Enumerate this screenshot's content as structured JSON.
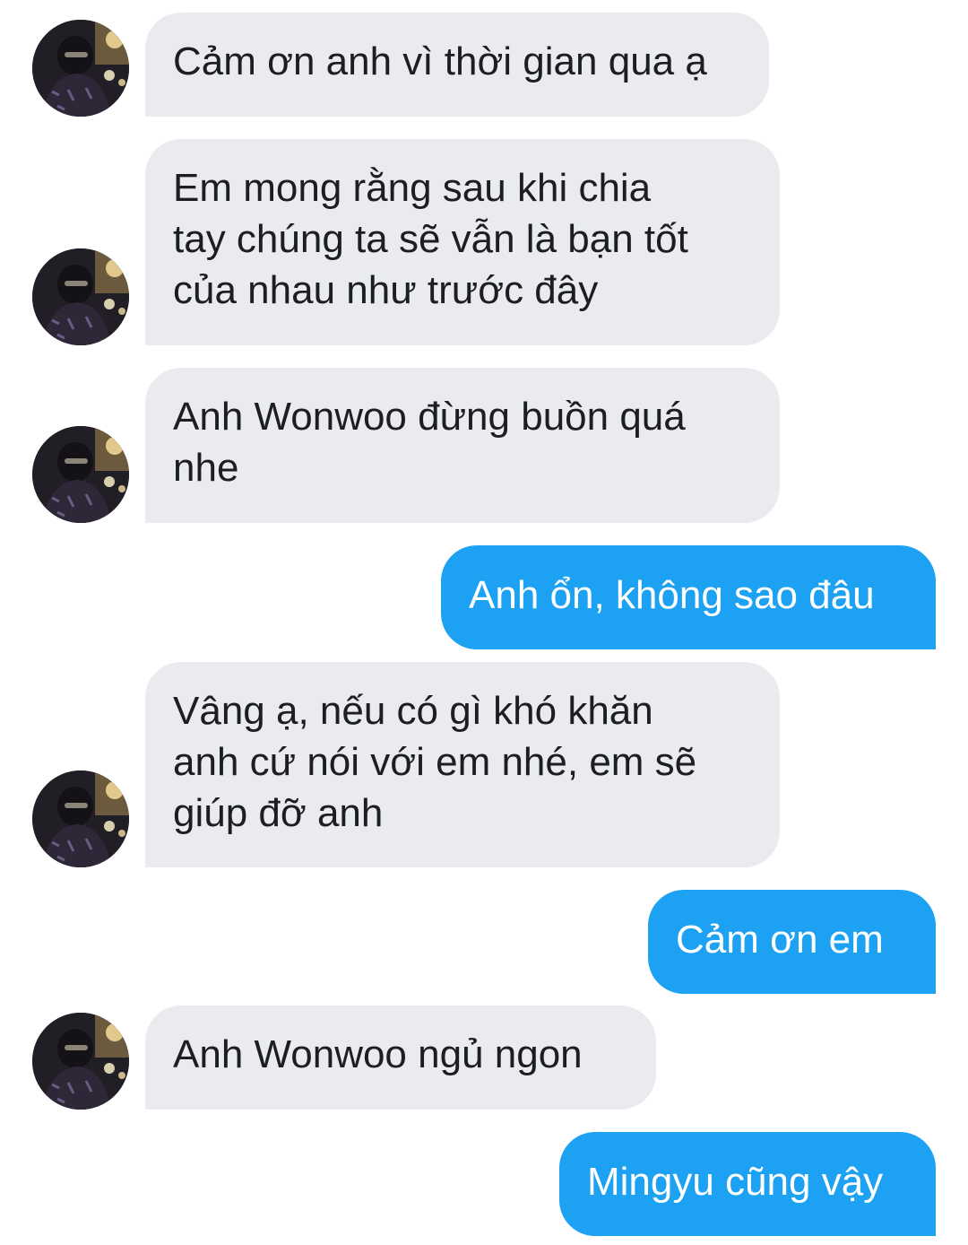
{
  "conversation": {
    "messages": [
      {
        "sender": "other",
        "text": "Cảm ơn anh vì thời gian qua ạ"
      },
      {
        "sender": "other",
        "text": "Em mong rằng sau khi chia\ntay chúng ta sẽ vẫn là bạn tốt\ncủa nhau như trước đây"
      },
      {
        "sender": "other",
        "text": "Anh Wonwoo đừng buồn quá\nnhe"
      },
      {
        "sender": "self",
        "text": "Anh ổn, không sao đâu"
      },
      {
        "sender": "other",
        "text": "Vâng ạ, nếu có gì khó khăn\nanh cứ nói với em nhé, em sẽ\ngiúp đỡ anh"
      },
      {
        "sender": "self",
        "text": "Cảm ơn em"
      },
      {
        "sender": "other",
        "text": "Anh Wonwoo ngủ ngon"
      },
      {
        "sender": "self",
        "text": "Mingyu cũng vậy"
      }
    ]
  },
  "colors": {
    "incoming_bubble": "#e9ebee",
    "incoming_text": "#1c1e21",
    "outgoing_bubble": "#1da1f2",
    "outgoing_text": "#ffffff"
  },
  "icons": {
    "avatar": "contact-avatar-photo"
  }
}
